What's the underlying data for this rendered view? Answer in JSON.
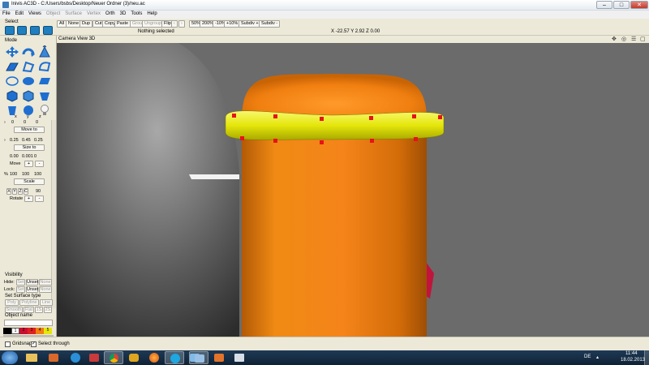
{
  "window": {
    "title": "Inivis AC3D - C:/Users/bsbs/Desktop/Neuer Ordner (3)/neu.ac",
    "controls": {
      "minimize": "–",
      "maximize": "□",
      "close": "✕"
    }
  },
  "menu": {
    "items": [
      {
        "label": "File",
        "enabled": true
      },
      {
        "label": "Edit",
        "enabled": true
      },
      {
        "label": "Views",
        "enabled": true
      },
      {
        "label": "Object",
        "enabled": false
      },
      {
        "label": "Surface",
        "enabled": false
      },
      {
        "label": "Vertex",
        "enabled": false
      },
      {
        "label": "Orth",
        "enabled": true
      },
      {
        "label": "3D",
        "enabled": true
      },
      {
        "label": "Tools",
        "enabled": true
      },
      {
        "label": "Help",
        "enabled": true
      }
    ]
  },
  "toolbar": {
    "select_label": "Select",
    "all": "All",
    "none": "None",
    "dup": "Dup",
    "cut": "Cut",
    "copy": "Copy",
    "paste": "Paste",
    "group": "Group",
    "ungroup": "Ungroup",
    "flip": "Flip",
    "zoom_50": "50%",
    "zoom_200": "200%",
    "zoom_m10": "-10%",
    "zoom_p10": "+10%",
    "subdiv_plus": "Subdiv +",
    "subdiv_minus": "Subdiv -",
    "status": "Nothing selected",
    "coords": "X -22.57 Y 2.92 Z 0.00"
  },
  "left_panel": {
    "mode_label": "Mode",
    "axis_labels": {
      "x": "x",
      "y": "y",
      "z": "z"
    },
    "move_to": {
      "values": [
        "0",
        "0",
        "0"
      ],
      "button": "Move to"
    },
    "size_to": {
      "values": [
        "0.25",
        "0.45",
        "0.25"
      ],
      "button": "Size to"
    },
    "move": {
      "values": [
        "0.00",
        "0.001",
        "0"
      ],
      "label": "Move",
      "plus": "+",
      "minus": "-"
    },
    "scale": {
      "prefix": "%",
      "values": [
        "100",
        "100",
        "100"
      ],
      "button": "Scale"
    },
    "rotate": {
      "axes": [
        "X",
        "Y",
        "Z",
        "C"
      ],
      "value": "90",
      "label": "Rotate",
      "plus": "+",
      "minus": "-"
    },
    "visibility": {
      "title": "Visibility",
      "hide": {
        "label": "Hide:",
        "set": "Set",
        "unset": "Unset",
        "none": "None"
      },
      "lock": {
        "label": "Lock:",
        "set": "Set",
        "unset": "Unset",
        "none": "None"
      }
    },
    "surface": {
      "title": "Set Surface type",
      "buttons": [
        "Poly",
        "Polyline",
        "Line",
        "Smooth",
        "Flat",
        "1S",
        "2S"
      ]
    },
    "object_name_label": "Object name",
    "palette_numbers": [
      "1",
      "2",
      "3",
      "4",
      "5"
    ]
  },
  "viewport": {
    "header_label": "Camera View 3D",
    "colors": {
      "background": "#6b6b6b",
      "cylinder": "#f07f10",
      "ring": "#e5e60a",
      "sphere": "#3a3a3a",
      "handle": "#e8121a"
    }
  },
  "statusbar": {
    "gridsnap_label": "Gridsnap",
    "gridsnap_checked": false,
    "selectthrough_label": "Select through",
    "selectthrough_checked": true
  },
  "taskbar": {
    "language": "DE",
    "time": "11:44",
    "date": "18.02.2013",
    "apps": [
      "windows-start",
      "file-explorer",
      "media-player",
      "internet-explorer",
      "app-launcher",
      "chrome",
      "games",
      "firefox",
      "skype",
      "paint",
      "ac3d",
      "sketch",
      "notes"
    ]
  }
}
